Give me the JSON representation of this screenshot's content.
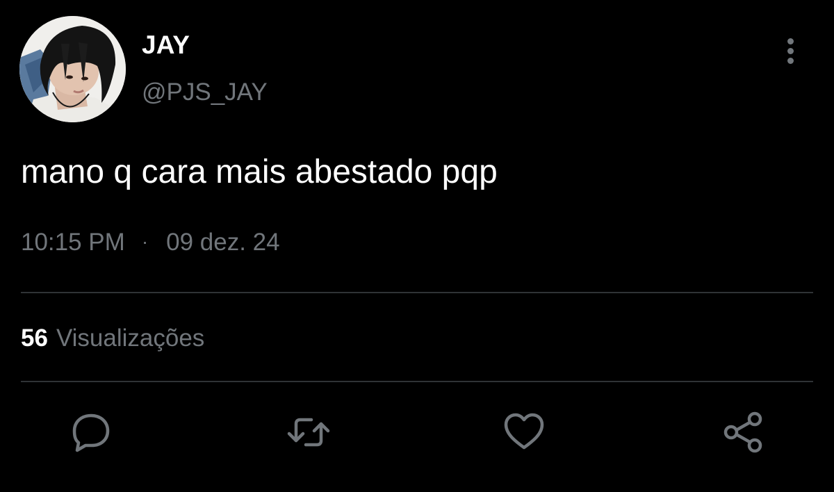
{
  "user": {
    "display_name": "JAY",
    "handle": "@PJS_JAY"
  },
  "tweet": {
    "text": "mano q cara mais abestado pqp",
    "time": "10:15 PM",
    "separator": "·",
    "date": "09 dez. 24"
  },
  "stats": {
    "views_count": "56",
    "views_label": "Visualizações"
  },
  "icons": {
    "more": "more-vertical-icon",
    "reply": "reply-icon",
    "retweet": "retweet-icon",
    "like": "heart-icon",
    "share": "share-icon"
  },
  "colors": {
    "background": "#000000",
    "primary_text": "#ffffff",
    "secondary_text": "#71767b",
    "divider": "#2f3336"
  }
}
